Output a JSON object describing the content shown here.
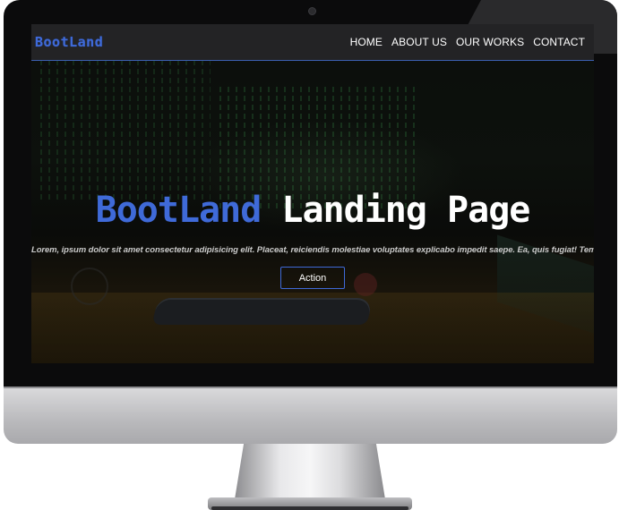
{
  "navbar": {
    "brand": "BootLand",
    "links": [
      "HOME",
      "ABOUT US",
      "OUR WORKS",
      "CONTACT"
    ]
  },
  "hero": {
    "title_brand": "BootLand",
    "title_rest": "Landing Page",
    "subtitle": "Lorem, ipsum dolor sit amet consectetur adipisicing elit. Placeat, reiciendis molestiae voluptates explicabo impedit saepe. Ea, quis fugiat! Tempora.",
    "action_label": "Action"
  },
  "colors": {
    "accent": "#3f6ad8",
    "navbar_bg": "#242426",
    "text": "#ffffff",
    "device_bezel": "#0b0b0c",
    "device_chin": "#c4c4c7"
  },
  "icons": {
    "camera": "camera-icon"
  }
}
